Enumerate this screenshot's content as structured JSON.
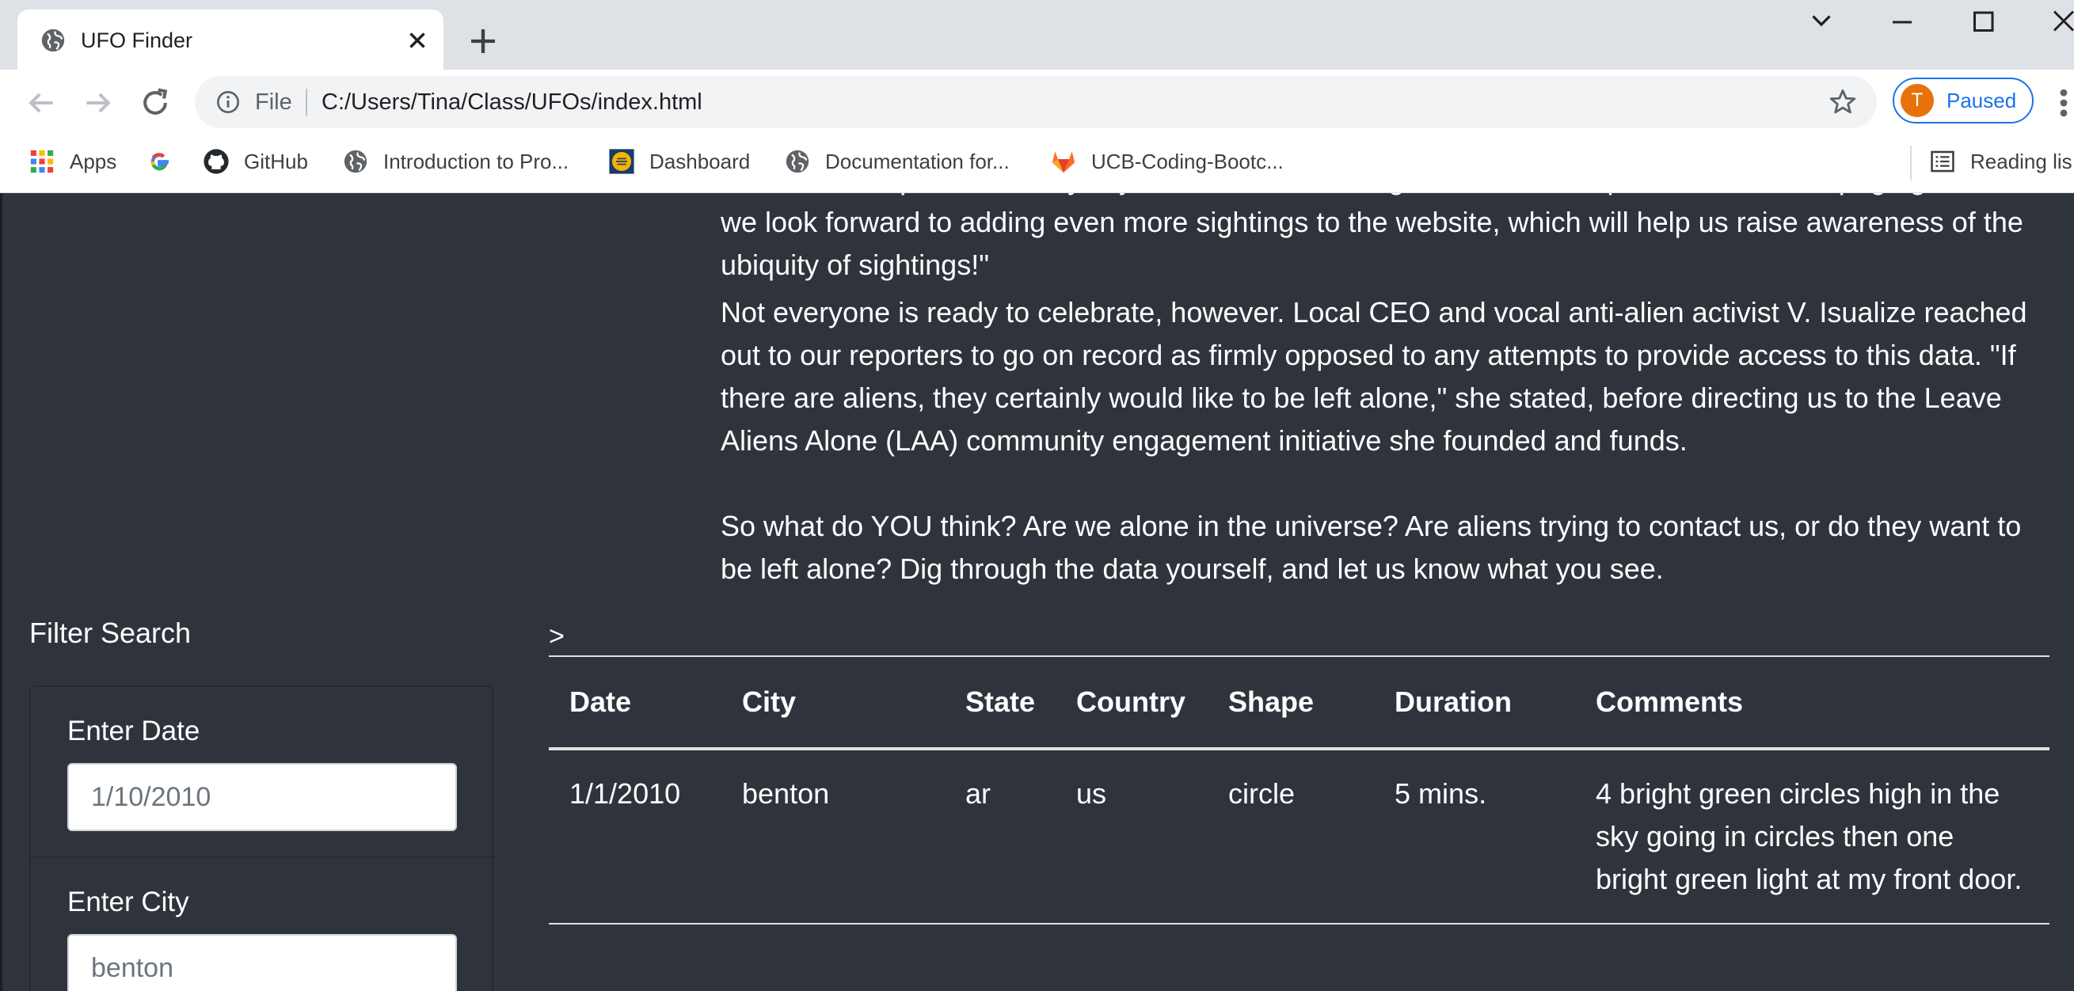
{
  "browser": {
    "tab_title": "UFO Finder",
    "address": {
      "scheme_label": "File",
      "url": "C:/Users/Tina/Class/UFOs/index.html"
    },
    "profile": {
      "initial": "T",
      "status": "Paused",
      "color": "#e8710a"
    },
    "bookmarks": [
      {
        "label": "Apps",
        "icon": "apps-grid-icon"
      },
      {
        "label": "",
        "icon": "google-icon"
      },
      {
        "label": "GitHub",
        "icon": "github-icon"
      },
      {
        "label": "Introduction to Pro...",
        "icon": "globe-icon"
      },
      {
        "label": "Dashboard",
        "icon": "dashboard-icon"
      },
      {
        "label": "Documentation for...",
        "icon": "globe-icon"
      },
      {
        "label": "UCB-Coding-Bootc...",
        "icon": "gitlab-icon"
      }
    ],
    "reading_list": "Reading lis"
  },
  "article": {
    "paragraphs": [
      "Over in the department, they're just as excited to bring this data to the public. As our webpage grows, we look forward to adding even more sightings to the website, which will help us raise awareness of the ubiquity of sightings!\"",
      "Not everyone is ready to celebrate, however. Local CEO and vocal anti-alien activist V. Isualize reached out to our reporters to go on record as firmly opposed to any attempts to provide access to this data. \"If there are aliens, they certainly would like to be left alone,\" she stated, before directing us to the Leave Aliens Alone (LAA) community engagement initiative she founded and funds.",
      "So what do YOU think? Are we alone in the universe? Are aliens trying to contact us, or do they want to be left alone? Dig through the data yourself, and let us know what you see."
    ]
  },
  "filters": {
    "title": "Filter Search",
    "items": [
      {
        "label": "Enter Date",
        "value": "1/10/2010"
      },
      {
        "label": "Enter City",
        "value": "benton"
      }
    ]
  },
  "table": {
    "prompt": ">",
    "headers": [
      "Date",
      "City",
      "State",
      "Country",
      "Shape",
      "Duration",
      "Comments"
    ],
    "rows": [
      [
        "1/1/2010",
        "benton",
        "ar",
        "us",
        "circle",
        "5 mins.",
        "4 bright green circles high in the sky going in circles then one bright green light at my front door."
      ]
    ]
  },
  "colors": {
    "page_background": "#2f343c",
    "link_blue": "#1a73e8"
  }
}
